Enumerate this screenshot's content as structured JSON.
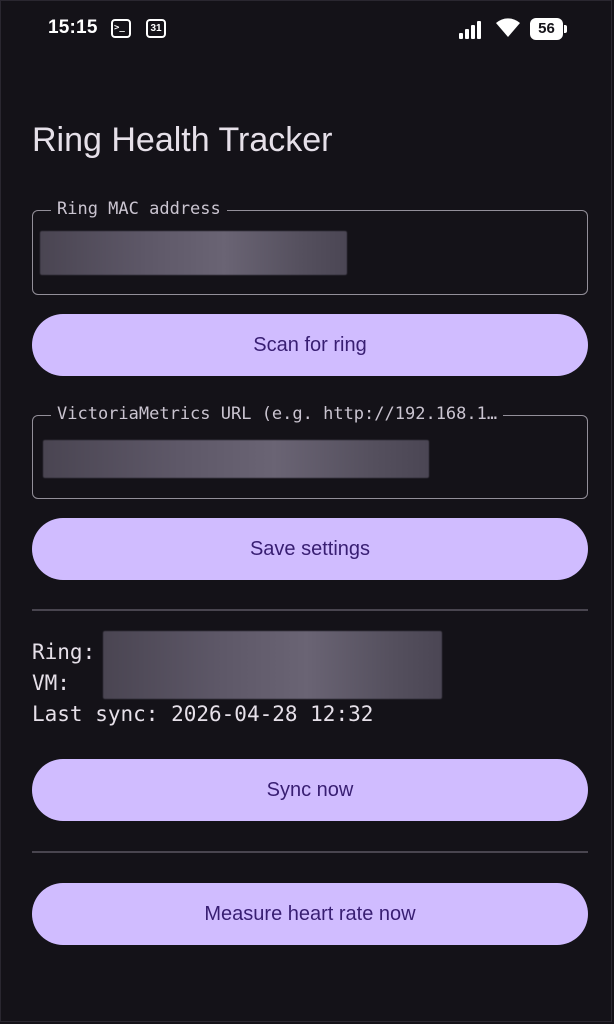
{
  "status_bar": {
    "time": "15:15",
    "calendar_day": "31",
    "battery_level": "56",
    "icons": [
      "terminal-icon",
      "calendar-icon",
      "signal-icon",
      "wifi-icon",
      "battery-icon"
    ]
  },
  "app": {
    "title": "Ring Health Tracker"
  },
  "ring_mac_field": {
    "label": "Ring MAC address",
    "value": "",
    "redacted": true
  },
  "scan_button": {
    "label": "Scan for ring"
  },
  "vm_url_field": {
    "label": "VictoriaMetrics URL (e.g. http://192.168.1…",
    "value": "",
    "redacted": true
  },
  "save_button": {
    "label": "Save settings"
  },
  "status": {
    "ring_label": "Ring:",
    "vm_label": "VM:",
    "last_sync_label": "Last sync:",
    "last_sync_value": "2026-04-28 12:32"
  },
  "sync_button": {
    "label": "Sync now"
  },
  "measure_button": {
    "label": "Measure heart rate now"
  },
  "colors": {
    "background": "#141218",
    "button_fill": "#d0bcff",
    "button_text": "#381e72",
    "outline": "#938f99",
    "text": "#e6e0e9"
  }
}
